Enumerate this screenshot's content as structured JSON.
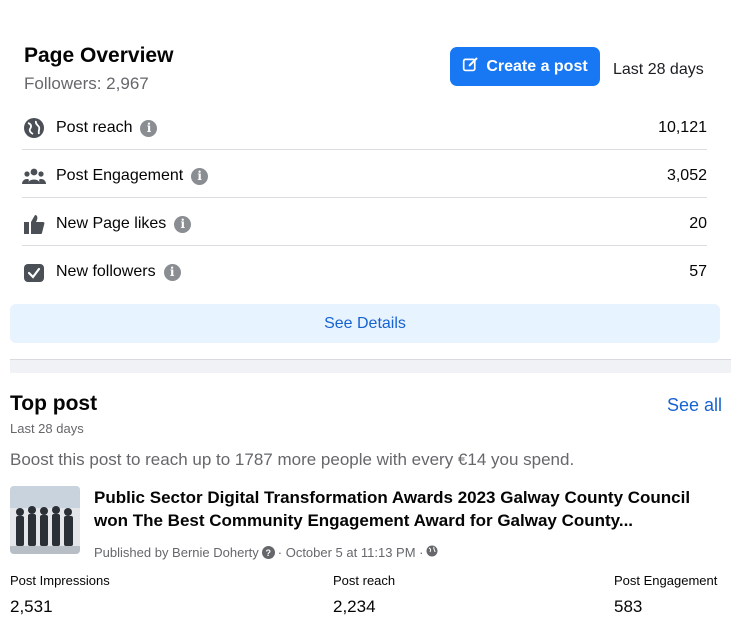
{
  "overview": {
    "title": "Page Overview",
    "followers": "Followers: 2,967",
    "create_post_label": "Create a post",
    "date_range": "Last 28 days",
    "metrics": [
      {
        "icon": "globe-icon",
        "label": "Post reach",
        "value": "10,121"
      },
      {
        "icon": "people-icon",
        "label": "Post Engagement",
        "value": "3,052"
      },
      {
        "icon": "thumbs-up-icon",
        "label": "New Page likes",
        "value": "20"
      },
      {
        "icon": "follow-check-icon",
        "label": "New followers",
        "value": "57"
      }
    ],
    "info_glyph": "i",
    "see_details_label": "See Details"
  },
  "top_post": {
    "title": "Top post",
    "subtitle": "Last 28 days",
    "see_all_label": "See all",
    "boost_text": "Boost this post to reach up to 1787 more people with every €14 you spend.",
    "post_text": "Public Sector Digital Transformation Awards 2023 Galway County Council won The Best Community Engagement Award for Galway County...",
    "meta_prefix": "Published by Bernie Doherty",
    "meta_suffix": "· October 5 at 11:13 PM ·",
    "question_glyph": "?",
    "stats": [
      {
        "label": "Post Impressions",
        "value": "2,531"
      },
      {
        "label": "Post reach",
        "value": "2,234"
      },
      {
        "label": "Post Engagement",
        "value": "583"
      }
    ]
  },
  "colors": {
    "accent": "#1877f2",
    "link": "#1763cf",
    "details_bg": "#e7f3ff",
    "muted": "#65676b"
  }
}
